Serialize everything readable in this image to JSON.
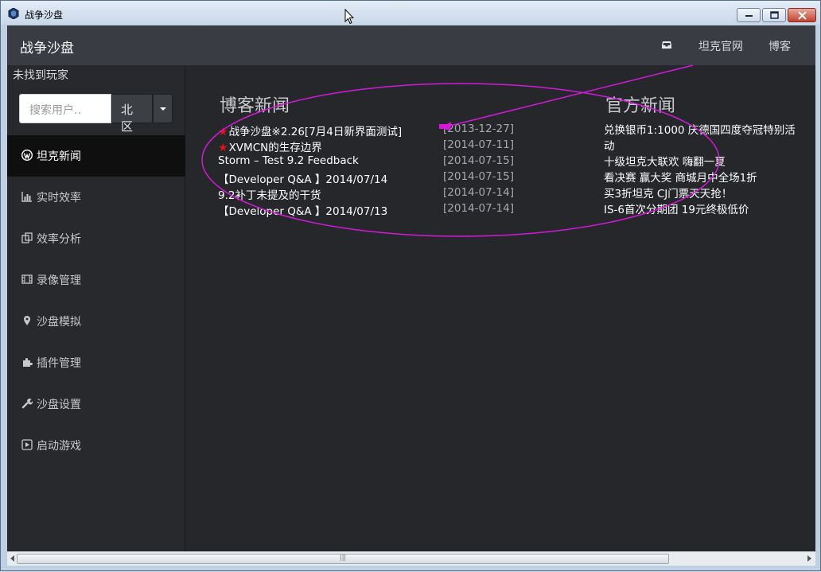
{
  "window": {
    "title": "战争沙盘"
  },
  "navbar": {
    "brand": "战争沙盘",
    "links": [
      {
        "label": "坦克官网"
      },
      {
        "label": "博客"
      }
    ],
    "icon": "inbox-icon"
  },
  "sidebar": {
    "status": "未找到玩家",
    "search": {
      "placeholder": "搜索用户..",
      "value": ""
    },
    "region": {
      "selected": "北区"
    },
    "items": [
      {
        "label": "坦克新闻",
        "icon": "wordpress-icon",
        "active": true
      },
      {
        "label": "实时效率",
        "icon": "bar-chart-icon"
      },
      {
        "label": "效率分析",
        "icon": "copy-icon"
      },
      {
        "label": "录像管理",
        "icon": "film-icon"
      },
      {
        "label": "沙盘模拟",
        "icon": "map-marker-icon"
      },
      {
        "label": "插件管理",
        "icon": "puzzle-icon"
      },
      {
        "label": "沙盘设置",
        "icon": "wrench-icon"
      },
      {
        "label": "启动游戏",
        "icon": "play-icon"
      }
    ]
  },
  "content": {
    "blog": {
      "title": "博客新闻",
      "items": [
        {
          "title": "战争沙盘※2.26[7月4日新界面测试]",
          "date": "[2013-12-27]",
          "starred": true
        },
        {
          "title": "XVMCN的生存边界",
          "date": "[2014-07-11]",
          "starred": true
        },
        {
          "title": "Storm – Test 9.2 Feedback",
          "date": "[2014-07-15]",
          "starred": false
        },
        {
          "title": "【Developer Q&A 】2014/07/14",
          "date": "[2014-07-15]",
          "starred": false
        },
        {
          "title": "9.2补丁未提及的干货",
          "date": "[2014-07-14]",
          "starred": false
        },
        {
          "title": "【Developer Q&A 】2014/07/13",
          "date": "[2014-07-14]",
          "starred": false
        }
      ]
    },
    "official": {
      "title": "官方新闻",
      "items": [
        {
          "title": "兑换银币1:1000 庆德国四度夺冠特别活动"
        },
        {
          "title": "十级坦克大联欢 嗨翻一夏"
        },
        {
          "title": "看决赛 赢大奖 商城月中全场1折"
        },
        {
          "title": "买3折坦克 CJ门票天天抢！"
        },
        {
          "title": "IS-6首次分期团 19元终极低价"
        }
      ]
    }
  },
  "colors": {
    "accent": "#e000e0",
    "star": "#e0141a",
    "navbar": "#393c42",
    "background": "#232529"
  }
}
